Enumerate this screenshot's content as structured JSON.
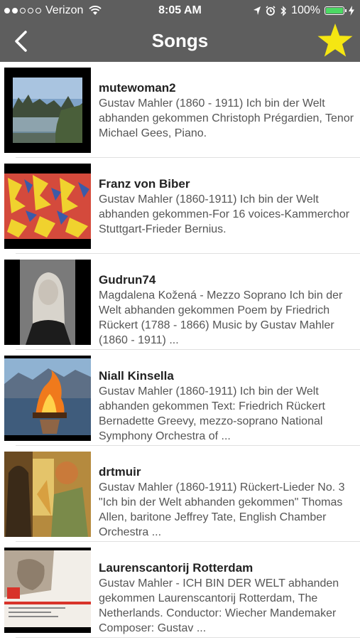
{
  "status_bar": {
    "carrier": "Verizon",
    "time": "8:05 AM",
    "battery": "100%"
  },
  "nav": {
    "title": "Songs"
  },
  "songs": [
    {
      "title": "mutewoman2",
      "description": "Gustav Mahler (1860 - 1911) Ich bin der Welt abhanden gekommen Christoph Prégardien, Tenor Michael Gees, Piano."
    },
    {
      "title": "Franz von Biber",
      "description": "Gustav Mahler (1860-1911) Ich bin der Welt abhanden gekommen-For 16 voices-Kammerchor Stuttgart-Frieder Bernius."
    },
    {
      "title": "Gudrun74",
      "description": "Magdalena Kožená - Mezzo Soprano Ich bin der Welt abhanden gekommen Poem by Friedrich Rückert (1788 - 1866) Music by Gustav Mahler (1860 - 1911) ..."
    },
    {
      "title": "Niall Kinsella",
      "description": "Gustav Mahler (1860-1911) Ich bin der Welt abhanden gekommen Text: Friedrich Rückert Bernadette Greevy, mezzo-soprano National Symphony Orchestra of ..."
    },
    {
      "title": "drtmuir",
      "description": "Gustav Mahler (1860-1911) Rückert-Lieder No. 3 \"Ich bin der Welt abhanden gekommen\" Thomas Allen, baritone Jeffrey Tate, English Chamber Orchestra ..."
    },
    {
      "title": "Laurenscantorij Rotterdam",
      "description": "Gustav Mahler - ICH BIN DER WELT abhanden gekommen Laurenscantorij Rotterdam, The Netherlands. Conductor: Wiecher Mandemaker Composer: Gustav ..."
    }
  ]
}
